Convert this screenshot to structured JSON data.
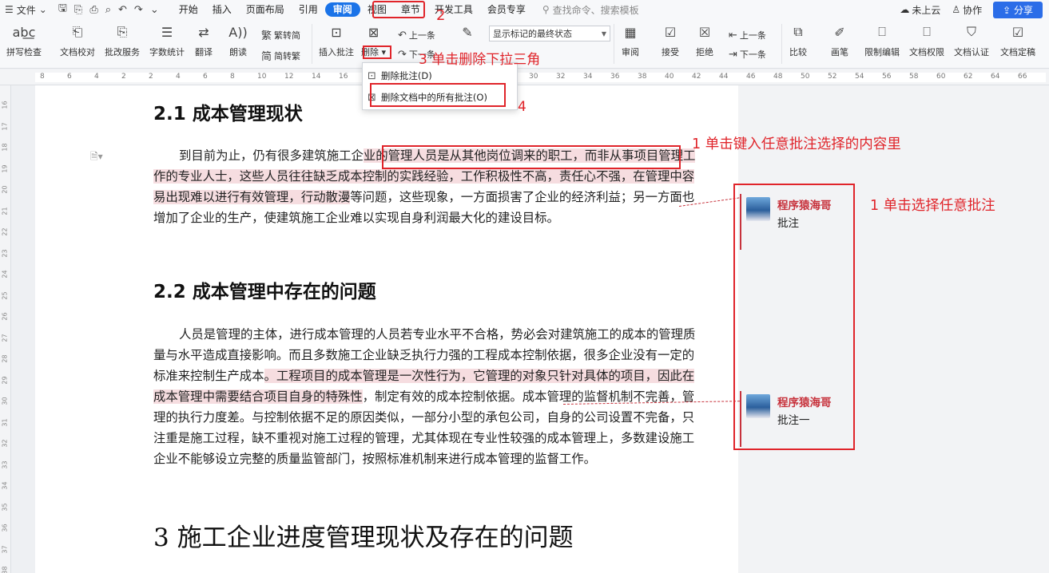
{
  "menubar": {
    "file_label": "文件",
    "tabs": [
      "开始",
      "插入",
      "页面布局",
      "引用",
      "审阅",
      "视图",
      "章节",
      "开发工具",
      "会员专享"
    ],
    "search_placeholder": "查找命令、搜索模板",
    "cloud_status": "未上云",
    "collab": "协作",
    "share": "分享"
  },
  "ribbon": {
    "spell_check": "拼写检查",
    "doc_proof": "文档校对",
    "batch_service": "批改服务",
    "word_count": "字数统计",
    "translate": "翻译",
    "read_aloud": "朗读",
    "trad_to_simp": "繁转简",
    "simp_to_trad": "简转繁",
    "insert_comment": "插入批注",
    "delete": "删除",
    "prev_comment": "上一条",
    "next_comment": "下一条",
    "markup_mode": "显示标记的最终状态",
    "review": "审阅",
    "accept": "接受",
    "reject": "拒绝",
    "prev_change": "上一条",
    "next_change": "下一条",
    "compare": "比较",
    "pen": "画笔",
    "restrict_edit": "限制编辑",
    "doc_permission": "文档权限",
    "doc_certify": "文档认证",
    "doc_finalize": "文档定稿"
  },
  "dropdown": {
    "delete_comment": "删除批注(D)",
    "delete_all_comments": "删除文档中的所有批注(O)"
  },
  "document": {
    "h_2_1": "2.1 成本管理现状",
    "p1": {
      "a": "到目前为止，仍有很多建筑施工企",
      "b": "业的管理人员是从其他岗位调来的职工，而非从事项目管理工作的专业人士，这些人员往往缺乏成本控制的实践经验，工作积极性不高，责任心不强，在管理中容易出现难以进行有效管理，行动散漫",
      "c": "等问题，这些现象，一方面损害了企业的经济利益；另一方面也增加了企业的生产，使建筑施工企业难以实现自身利润最大化的建设目标。"
    },
    "h_2_2": "2.2 成本管理中存在的问题",
    "p2": {
      "a": "人员是管理的主体，进行成本管理的人员若专业水平不合格，势必会对建筑施工的成本的管理质量与水平造成直接影响。而且多数施工企业缺乏执行力强的工程成本控制依据，很多企业没有一定的标准来控制生产成本",
      "b": "。工程项目的成本管理是一次性行为，它管理的对象只针对具体的项目，因此在成本管理中需要结合项目自身的特殊性",
      "c": "，制定有效的成本控制依据。成本管理的监督机制不完善，管理的执行力度差。与控制依据不足的原因类似，一部分小型的承包公司，自身的公司设置不完备，只注重是施工过程，缺不重视对施工过程的管理，尤其体现在专业性较强的成本管理上，多数建设施工企业不能够设立完整的质量监管部门，按照标准机制来进行成本管理的监督工作。"
    },
    "h_3": "3 施工企业进度管理现状及存在的问题"
  },
  "comments": [
    {
      "author": "程序猿海哥",
      "text": "批注"
    },
    {
      "author": "程序猿海哥",
      "text": "批注一"
    }
  ],
  "annotations": {
    "step1a": "1 单击键入任意批注选择的内容里",
    "step1b": "1 单击选择任意批注",
    "step2": "2",
    "step3": "3 单击删除下拉三角",
    "step4": "4"
  },
  "ruler": {
    "h_ticks": [
      "8",
      "6",
      "4",
      "2",
      "2",
      "4",
      "6",
      "8",
      "10",
      "12",
      "14",
      "16",
      "18",
      "20",
      "22",
      "24",
      "26",
      "28",
      "30",
      "32",
      "34",
      "36",
      "38",
      "40",
      "42",
      "44",
      "46",
      "48",
      "50",
      "52",
      "54",
      "56",
      "58",
      "60",
      "62",
      "64",
      "66"
    ],
    "v_ticks": [
      "16",
      "17",
      "18",
      "19",
      "20",
      "21",
      "22",
      "23",
      "24",
      "25",
      "26",
      "27",
      "28",
      "29",
      "30",
      "31",
      "32",
      "33",
      "34",
      "35",
      "36",
      "37",
      "38"
    ]
  },
  "colors": {
    "accent": "#1a73e8",
    "comment_red": "#c7323c",
    "annotation_red": "#e0242a",
    "highlight": "#f6dde0"
  }
}
